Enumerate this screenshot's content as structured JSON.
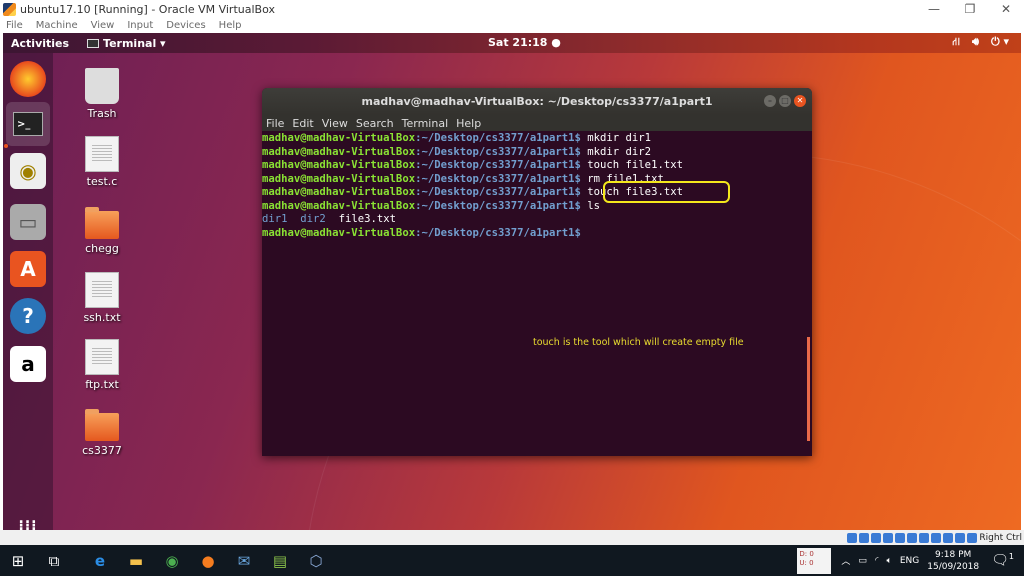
{
  "host_window": {
    "title": "ubuntu17.10 [Running] - Oracle VM VirtualBox",
    "menu": [
      "File",
      "Machine",
      "View",
      "Input",
      "Devices",
      "Help"
    ],
    "controls": [
      "minimize",
      "restore",
      "close"
    ]
  },
  "topbar": {
    "activities": "Activities",
    "app_menu": "Terminal ▾",
    "clock": "Sat 21:18 ●",
    "tray": [
      "network-icon",
      "volume-icon",
      "power-icon ▾"
    ]
  },
  "dock": [
    "Firefox",
    "Terminal",
    "Rhythmbox",
    "Files",
    "Ubuntu Software",
    "Help",
    "Amazon",
    "Show Applications"
  ],
  "desktop_icons": [
    "Trash",
    "test.c",
    "chegg",
    "ssh.txt",
    "ftp.txt",
    "cs3377"
  ],
  "terminal": {
    "title": "madhav@madhav-VirtualBox: ~/Desktop/cs3377/a1part1",
    "menu": [
      "File",
      "Edit",
      "View",
      "Search",
      "Terminal",
      "Help"
    ],
    "user": "madhav@madhav-VirtualBox",
    "path": ":~/Desktop/cs3377/a1part1$",
    "commands": [
      " mkdir dir1",
      " mkdir dir2",
      " touch file1.txt",
      " rm file1.txt",
      " touch file3.txt",
      " ls"
    ],
    "ls_output": [
      "dir1",
      "dir2",
      "file3.txt"
    ],
    "annotation": "touch is the tool which will create empty file",
    "highlight_color": "#f4e81c"
  },
  "vb_status": {
    "host_key": "Right Ctrl"
  },
  "taskbar": {
    "apps": [
      "start",
      "task-view",
      "edge",
      "explorer",
      "chrome",
      "firefox",
      "thunderbird",
      "notepad",
      "virtualbox"
    ],
    "netmon": [
      "D: 0",
      "U: 0"
    ],
    "language": "ENG",
    "time": "9:18 PM",
    "date": "15/09/2018",
    "notifications": "1"
  }
}
